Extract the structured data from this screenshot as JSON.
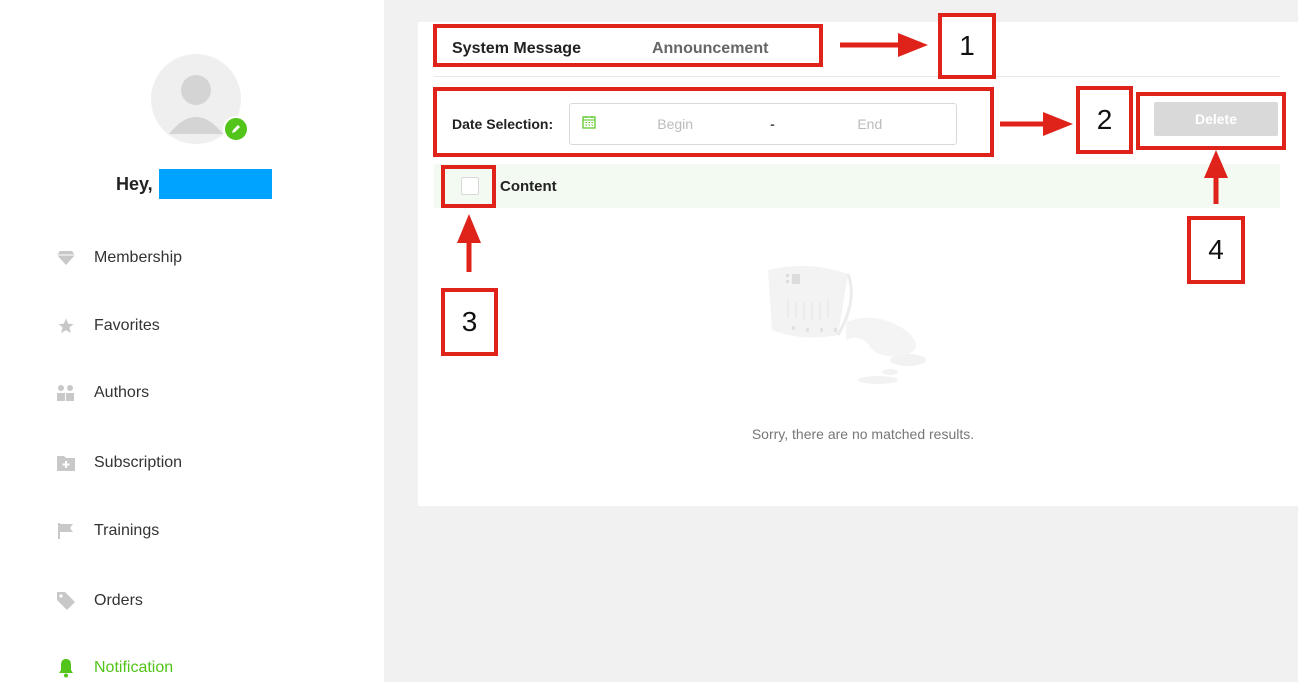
{
  "sidebar": {
    "greeting": "Hey,",
    "items": [
      {
        "label": "Membership",
        "icon": "diamond-icon"
      },
      {
        "label": "Favorites",
        "icon": "star-icon"
      },
      {
        "label": "Authors",
        "icon": "people-icon"
      },
      {
        "label": "Subscription",
        "icon": "folder-plus-icon"
      },
      {
        "label": "Trainings",
        "icon": "flag-icon"
      },
      {
        "label": "Orders",
        "icon": "tag-icon"
      },
      {
        "label": "Notification",
        "icon": "bell-icon",
        "active": true
      }
    ]
  },
  "tabs": {
    "system": "System Message",
    "announcement": "Announcement"
  },
  "filter": {
    "label": "Date Selection:",
    "begin": "Begin",
    "separator": "-",
    "end": "End"
  },
  "toolbar": {
    "delete_label": "Delete"
  },
  "table": {
    "column_content": "Content"
  },
  "empty": {
    "message": "Sorry, there are no matched results."
  },
  "annotations": {
    "n1": "1",
    "n2": "2",
    "n3": "3",
    "n4": "4"
  },
  "colors": {
    "accent": "#52c41a",
    "annotation": "#e0231a",
    "redaction": "#00a3ff"
  }
}
